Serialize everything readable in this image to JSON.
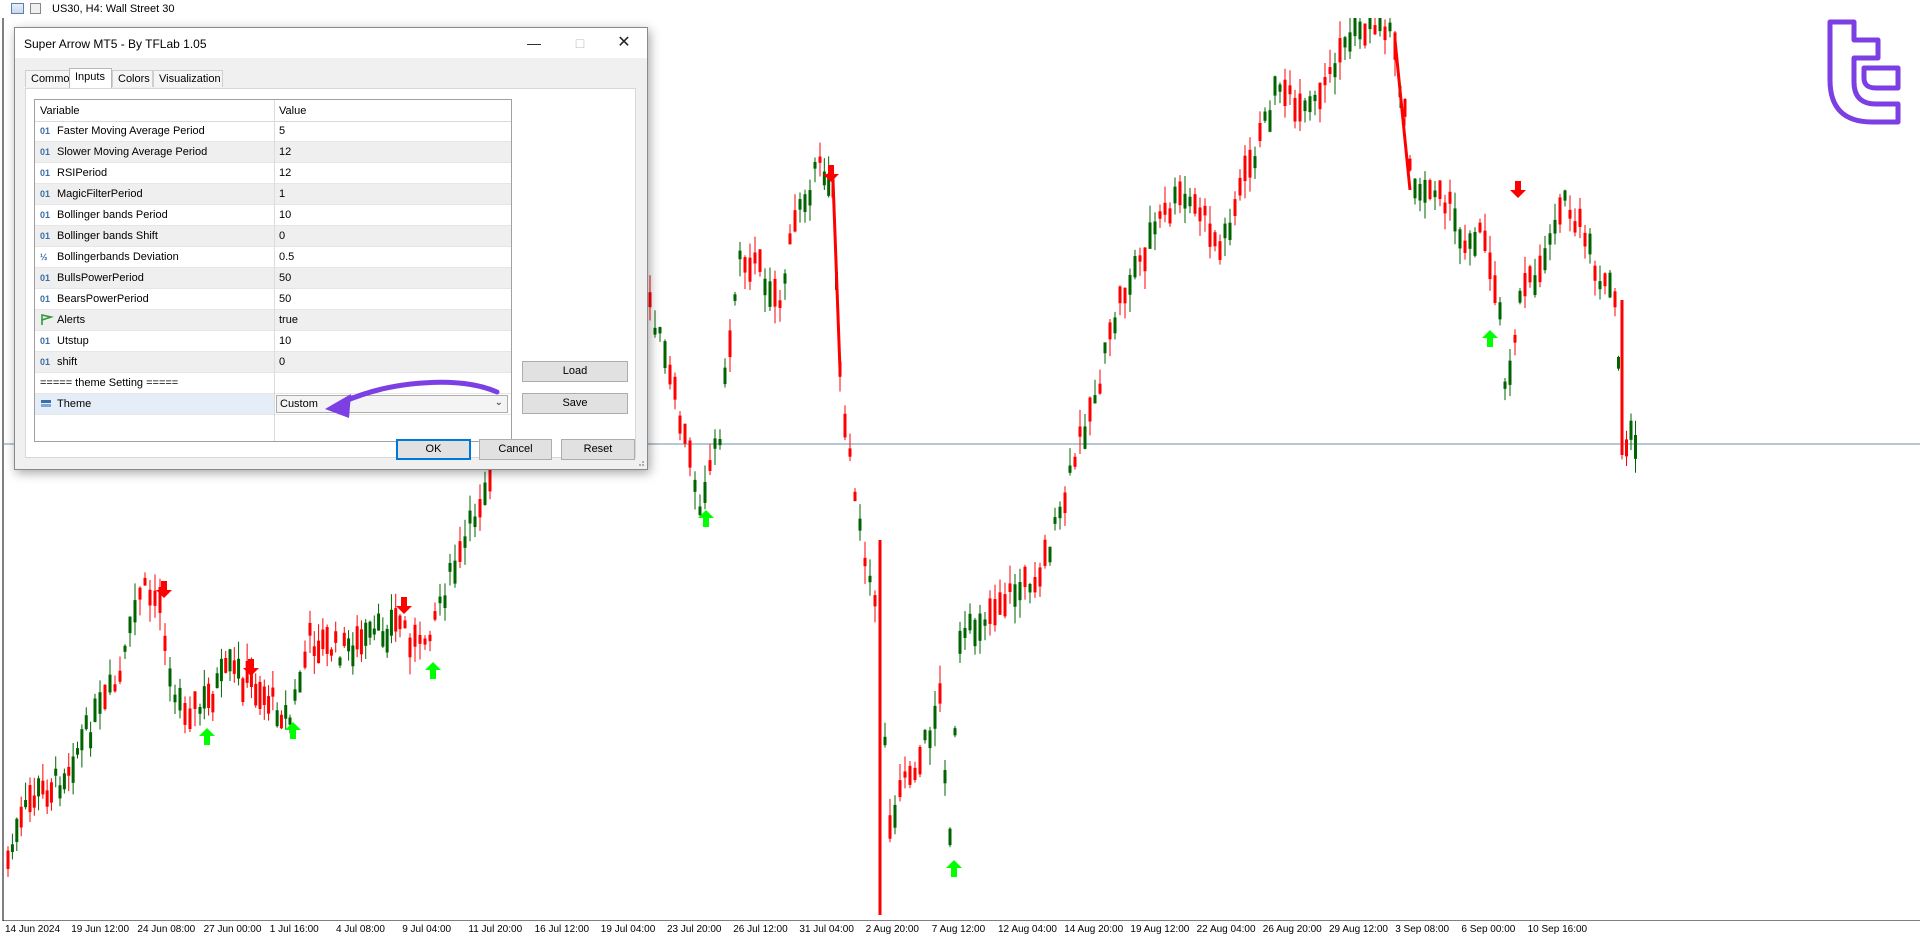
{
  "window": {
    "title": "US30, H4:  Wall Street 30"
  },
  "chart": {
    "colors": {
      "bull_candle": "#006400",
      "bear_candle": "#ff0000",
      "buy_arrow": "#00ff00",
      "sell_arrow": "#ff0000",
      "hline": "#6f8fa8",
      "background": "#ffffff"
    },
    "x_labels": [
      "14 Jun 2024",
      "19 Jun 12:00",
      "24 Jun 08:00",
      "27 Jun 00:00",
      "1 Jul 16:00",
      "4 Jul 08:00",
      "9 Jul 04:00",
      "11 Jul 20:00",
      "16 Jul 12:00",
      "19 Jul 04:00",
      "23 Jul 20:00",
      "26 Jul 12:00",
      "31 Jul 04:00",
      "2 Aug 20:00",
      "7 Aug 12:00",
      "12 Aug 04:00",
      "14 Aug 20:00",
      "19 Aug 12:00",
      "22 Aug 04:00",
      "26 Aug 20:00",
      "29 Aug 12:00",
      "3 Sep 08:00",
      "6 Sep 00:00",
      "10 Sep 16:00"
    ]
  },
  "logo": {
    "name": "tflab-logo",
    "color": "#7b3fe4"
  },
  "dialog": {
    "title": "Super Arrow MT5 - By TFLab 1.05",
    "tabs": [
      {
        "label": "Common"
      },
      {
        "label": "Inputs"
      },
      {
        "label": "Colors"
      },
      {
        "label": "Visualization"
      }
    ],
    "active_tab": "Inputs",
    "grid": {
      "col_variable": "Variable",
      "col_value": "Value",
      "rows": [
        {
          "icon": "01",
          "variable": "Faster Moving Average Period",
          "value": "5"
        },
        {
          "icon": "01",
          "variable": "Slower Moving Average Period",
          "value": "12"
        },
        {
          "icon": "01",
          "variable": "RSIPeriod",
          "value": "12"
        },
        {
          "icon": "01",
          "variable": "MagicFilterPeriod",
          "value": "1"
        },
        {
          "icon": "01",
          "variable": "Bollinger bands Period",
          "value": "10"
        },
        {
          "icon": "01",
          "variable": "Bollinger bands Shift",
          "value": "0"
        },
        {
          "icon": "½",
          "variable": "Bollingerbands Deviation",
          "value": "0.5"
        },
        {
          "icon": "01",
          "variable": "BullsPowerPeriod",
          "value": "50"
        },
        {
          "icon": "01",
          "variable": "BearsPowerPeriod",
          "value": "50"
        },
        {
          "icon": "flag",
          "variable": "Alerts",
          "value": "true"
        },
        {
          "icon": "01",
          "variable": "Utstup",
          "value": "10"
        },
        {
          "icon": "01",
          "variable": "shift",
          "value": "0"
        }
      ],
      "section": "===== theme Setting =====",
      "theme": {
        "variable": "Theme",
        "value": "Custom"
      }
    },
    "buttons": {
      "load": "Load",
      "save": "Save",
      "ok": "OK",
      "cancel": "Cancel",
      "reset": "Reset"
    },
    "annotation_arrow_color": "#7b3fe4"
  }
}
